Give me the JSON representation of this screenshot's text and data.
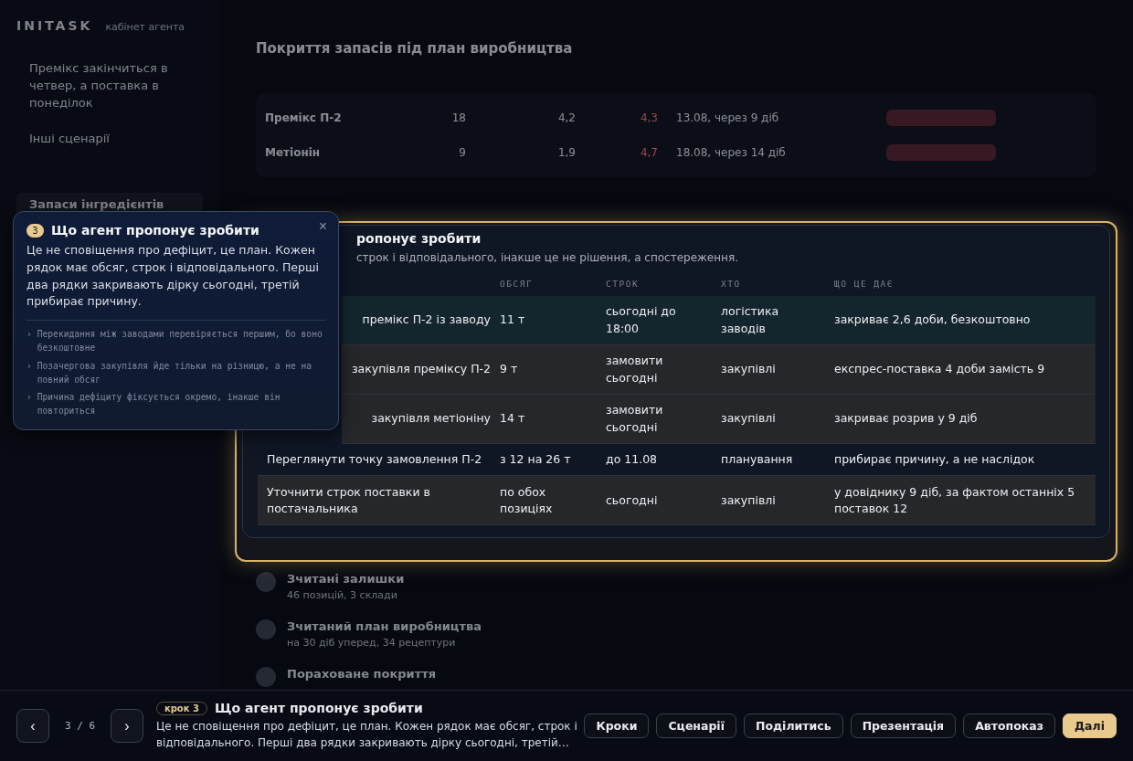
{
  "background": {
    "brand": "INITASK",
    "brand_sub": "кабінет агента",
    "sidebar_items": [
      {
        "label": "Премікс закінчиться в четвер, а поставка в понеділок",
        "selected": false
      },
      {
        "label": "Інші сценарії",
        "selected": false
      },
      {
        "label": "Запаси інгредієнтів",
        "selected": true
      }
    ],
    "title": "Покриття запасів під план виробництва",
    "rows": [
      {
        "name": "Премікс П-2",
        "stock": "18",
        "use": "4,2",
        "days": "4,3",
        "date": "13.08, через 9 діб"
      },
      {
        "name": "Метіонін",
        "stock": "9",
        "use": "1,9",
        "days": "4,7",
        "date": "18.08, через 14 діб"
      }
    ],
    "steps": [
      {
        "title": "Зчитані залишки",
        "sub": "46 позицій, 3 склади"
      },
      {
        "title": "Зчитаний план виробництва",
        "sub": "на 30 діб уперед, 34 рецептури"
      },
      {
        "title": "Пораховане покриття"
      }
    ]
  },
  "card": {
    "title": "ропонує зробити",
    "subtitle": "строк і відповідального, інакше це не рішення, а спостереження.",
    "columns": [
      "",
      "ОБСЯГ",
      "СТРОК",
      "ХТО",
      "ЩО ЦЕ ДАЄ"
    ],
    "rows": [
      {
        "covered": true,
        "selected": true,
        "shaded": true,
        "cells": [
          "премікс П-2 із заводу",
          "11 т",
          "сьогодні до 18:00",
          "логістика заводів",
          "закриває 2,6 доби, безкоштовно"
        ]
      },
      {
        "covered": true,
        "selected": false,
        "shaded": true,
        "cells": [
          "закупівля преміксу П-2",
          "9 т",
          "замовити сьогодні",
          "закупівлі",
          "експрес-поставка 4 доби замість 9"
        ]
      },
      {
        "covered": true,
        "selected": false,
        "shaded": true,
        "cells": [
          "закупівля метіоніну",
          "14 т",
          "замовити сьогодні",
          "закупівлі",
          "закриває розрив у 9 діб"
        ]
      },
      {
        "covered": false,
        "selected": false,
        "shaded": false,
        "cells": [
          "Переглянути точку замовлення П-2",
          "з 12 на 26 т",
          "до 11.08",
          "планування",
          "прибирає причину, а не наслідок"
        ]
      },
      {
        "covered": false,
        "selected": false,
        "shaded": true,
        "cells": [
          "Уточнити строк поставки в постачальника",
          "по обох позиціях",
          "сьогодні",
          "закупівлі",
          "у довіднику 9 діб, за фактом останніх 5 поставок 12"
        ]
      }
    ]
  },
  "note": {
    "badge": "3",
    "title": "Що агент пропонує зробити",
    "close": "×",
    "body": "Це не сповіщення про дефіцит, це план. Кожен рядок має обсяг, строк і відповідального. Перші два рядки закривають дірку сьогодні, третій прибирає причину.",
    "bullet_mark": "›",
    "bullets": [
      "Перекидання між заводами перевіряється першим, бо воно безкоштовне",
      "Позачергова закупівля йде тільки на різницю, а не на повний обсяг",
      "Причина дефіциту фіксується окремо, інакше він повториться"
    ]
  },
  "footer": {
    "prev": "‹",
    "counter": "3 / 6",
    "next": "›",
    "step": "крок 3",
    "title": "Що агент пропонує зробити",
    "text": "Це не сповіщення про дефіцит, це план. Кожен рядок має обсяг, строк і відповідального. Перші два рядки закривають дірку сьогодні, третій…",
    "buttons": [
      {
        "label": "Кроки",
        "selected": false
      },
      {
        "label": "Сценарії",
        "selected": false
      },
      {
        "label": "Поділитись",
        "selected": false
      },
      {
        "label": "Презентація",
        "selected": false
      },
      {
        "label": "Автопоказ",
        "selected": false
      },
      {
        "label": "Далі",
        "selected": true
      }
    ]
  }
}
